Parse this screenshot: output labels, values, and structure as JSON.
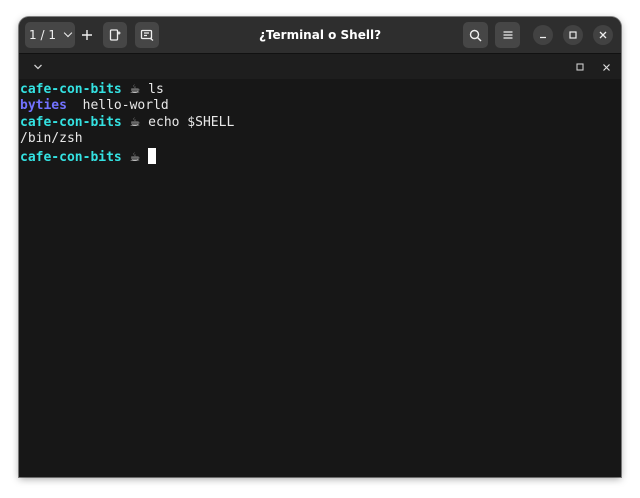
{
  "window": {
    "title": "¿Terminal o Shell?"
  },
  "headerbar": {
    "tab_counter": "1 / 1"
  },
  "terminal": {
    "prompt_user": "cafe-con-bits",
    "prompt_symbol": "☕",
    "line1_command": "ls",
    "line2_dir": "byties",
    "line2_file": "hello-world",
    "line3_command": "echo $SHELL",
    "line4_output": "/bin/zsh"
  },
  "colors": {
    "prompt": "#34e2e2",
    "directory": "#7272ff",
    "foreground": "#e8e8e8",
    "background": "#171717",
    "headerbar": "#2e2e2e"
  },
  "icons": {
    "tab_switch": "chevron-down-icon",
    "new_tab": "plus-icon",
    "split": "split-icon",
    "new_window": "new-window-icon",
    "search": "search-icon",
    "menu": "hamburger-icon",
    "minimize": "minimize-icon",
    "maximize": "maximize-icon",
    "close": "close-icon"
  }
}
